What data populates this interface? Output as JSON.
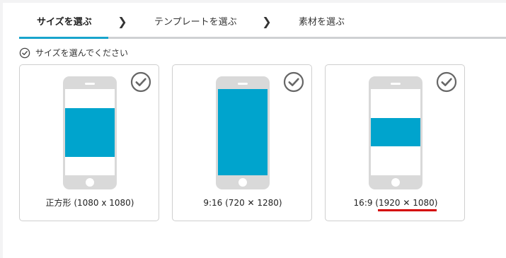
{
  "steps": [
    {
      "label": "サイズを選ぶ",
      "active": true
    },
    {
      "label": "テンプレートを選ぶ",
      "active": false
    },
    {
      "label": "素材を選ぶ",
      "active": false
    }
  ],
  "hint": {
    "text": "サイズを選んでください",
    "icon": "check-circle-icon"
  },
  "cards": [
    {
      "label": "正方形 (1080 x 1080)",
      "ratio": "1:1",
      "selected_icon": "check-circle-icon"
    },
    {
      "label": "9:16 (720 ✕ 1280)",
      "ratio": "9:16",
      "selected_icon": "check-circle-icon"
    },
    {
      "label": "16:9 (1920 ✕ 1080)",
      "ratio": "16:9",
      "selected_icon": "check-circle-icon"
    }
  ],
  "colors": {
    "accent": "#18a4cc",
    "media": "#00a4cd",
    "phone": "#d9d9d9",
    "underline": "#d40000"
  }
}
